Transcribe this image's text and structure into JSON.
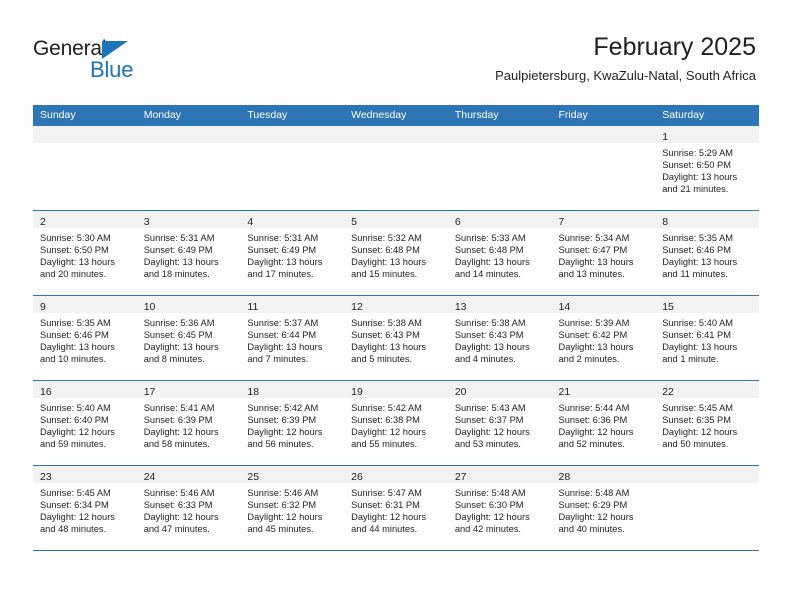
{
  "brand": {
    "name_top": "General",
    "name_bottom": "Blue",
    "accent_color": "#1b75bb"
  },
  "header": {
    "title": "February 2025",
    "subtitle": "Paulpietersburg, KwaZulu-Natal, South Africa"
  },
  "colors": {
    "header_row": "#2e75b6",
    "daynum_band": "#f2f2f2",
    "text": "#231f20"
  },
  "weekday_headers": [
    "Sunday",
    "Monday",
    "Tuesday",
    "Wednesday",
    "Thursday",
    "Friday",
    "Saturday"
  ],
  "weeks": [
    [
      {
        "day": "",
        "sunrise": "",
        "sunset": "",
        "daylight_line1": "",
        "daylight_line2": ""
      },
      {
        "day": "",
        "sunrise": "",
        "sunset": "",
        "daylight_line1": "",
        "daylight_line2": ""
      },
      {
        "day": "",
        "sunrise": "",
        "sunset": "",
        "daylight_line1": "",
        "daylight_line2": ""
      },
      {
        "day": "",
        "sunrise": "",
        "sunset": "",
        "daylight_line1": "",
        "daylight_line2": ""
      },
      {
        "day": "",
        "sunrise": "",
        "sunset": "",
        "daylight_line1": "",
        "daylight_line2": ""
      },
      {
        "day": "",
        "sunrise": "",
        "sunset": "",
        "daylight_line1": "",
        "daylight_line2": ""
      },
      {
        "day": "1",
        "sunrise": "Sunrise: 5:29 AM",
        "sunset": "Sunset: 6:50 PM",
        "daylight_line1": "Daylight: 13 hours",
        "daylight_line2": "and 21 minutes."
      }
    ],
    [
      {
        "day": "2",
        "sunrise": "Sunrise: 5:30 AM",
        "sunset": "Sunset: 6:50 PM",
        "daylight_line1": "Daylight: 13 hours",
        "daylight_line2": "and 20 minutes."
      },
      {
        "day": "3",
        "sunrise": "Sunrise: 5:31 AM",
        "sunset": "Sunset: 6:49 PM",
        "daylight_line1": "Daylight: 13 hours",
        "daylight_line2": "and 18 minutes."
      },
      {
        "day": "4",
        "sunrise": "Sunrise: 5:31 AM",
        "sunset": "Sunset: 6:49 PM",
        "daylight_line1": "Daylight: 13 hours",
        "daylight_line2": "and 17 minutes."
      },
      {
        "day": "5",
        "sunrise": "Sunrise: 5:32 AM",
        "sunset": "Sunset: 6:48 PM",
        "daylight_line1": "Daylight: 13 hours",
        "daylight_line2": "and 15 minutes."
      },
      {
        "day": "6",
        "sunrise": "Sunrise: 5:33 AM",
        "sunset": "Sunset: 6:48 PM",
        "daylight_line1": "Daylight: 13 hours",
        "daylight_line2": "and 14 minutes."
      },
      {
        "day": "7",
        "sunrise": "Sunrise: 5:34 AM",
        "sunset": "Sunset: 6:47 PM",
        "daylight_line1": "Daylight: 13 hours",
        "daylight_line2": "and 13 minutes."
      },
      {
        "day": "8",
        "sunrise": "Sunrise: 5:35 AM",
        "sunset": "Sunset: 6:46 PM",
        "daylight_line1": "Daylight: 13 hours",
        "daylight_line2": "and 11 minutes."
      }
    ],
    [
      {
        "day": "9",
        "sunrise": "Sunrise: 5:35 AM",
        "sunset": "Sunset: 6:46 PM",
        "daylight_line1": "Daylight: 13 hours",
        "daylight_line2": "and 10 minutes."
      },
      {
        "day": "10",
        "sunrise": "Sunrise: 5:36 AM",
        "sunset": "Sunset: 6:45 PM",
        "daylight_line1": "Daylight: 13 hours",
        "daylight_line2": "and 8 minutes."
      },
      {
        "day": "11",
        "sunrise": "Sunrise: 5:37 AM",
        "sunset": "Sunset: 6:44 PM",
        "daylight_line1": "Daylight: 13 hours",
        "daylight_line2": "and 7 minutes."
      },
      {
        "day": "12",
        "sunrise": "Sunrise: 5:38 AM",
        "sunset": "Sunset: 6:43 PM",
        "daylight_line1": "Daylight: 13 hours",
        "daylight_line2": "and 5 minutes."
      },
      {
        "day": "13",
        "sunrise": "Sunrise: 5:38 AM",
        "sunset": "Sunset: 6:43 PM",
        "daylight_line1": "Daylight: 13 hours",
        "daylight_line2": "and 4 minutes."
      },
      {
        "day": "14",
        "sunrise": "Sunrise: 5:39 AM",
        "sunset": "Sunset: 6:42 PM",
        "daylight_line1": "Daylight: 13 hours",
        "daylight_line2": "and 2 minutes."
      },
      {
        "day": "15",
        "sunrise": "Sunrise: 5:40 AM",
        "sunset": "Sunset: 6:41 PM",
        "daylight_line1": "Daylight: 13 hours",
        "daylight_line2": "and 1 minute."
      }
    ],
    [
      {
        "day": "16",
        "sunrise": "Sunrise: 5:40 AM",
        "sunset": "Sunset: 6:40 PM",
        "daylight_line1": "Daylight: 12 hours",
        "daylight_line2": "and 59 minutes."
      },
      {
        "day": "17",
        "sunrise": "Sunrise: 5:41 AM",
        "sunset": "Sunset: 6:39 PM",
        "daylight_line1": "Daylight: 12 hours",
        "daylight_line2": "and 58 minutes."
      },
      {
        "day": "18",
        "sunrise": "Sunrise: 5:42 AM",
        "sunset": "Sunset: 6:39 PM",
        "daylight_line1": "Daylight: 12 hours",
        "daylight_line2": "and 56 minutes."
      },
      {
        "day": "19",
        "sunrise": "Sunrise: 5:42 AM",
        "sunset": "Sunset: 6:38 PM",
        "daylight_line1": "Daylight: 12 hours",
        "daylight_line2": "and 55 minutes."
      },
      {
        "day": "20",
        "sunrise": "Sunrise: 5:43 AM",
        "sunset": "Sunset: 6:37 PM",
        "daylight_line1": "Daylight: 12 hours",
        "daylight_line2": "and 53 minutes."
      },
      {
        "day": "21",
        "sunrise": "Sunrise: 5:44 AM",
        "sunset": "Sunset: 6:36 PM",
        "daylight_line1": "Daylight: 12 hours",
        "daylight_line2": "and 52 minutes."
      },
      {
        "day": "22",
        "sunrise": "Sunrise: 5:45 AM",
        "sunset": "Sunset: 6:35 PM",
        "daylight_line1": "Daylight: 12 hours",
        "daylight_line2": "and 50 minutes."
      }
    ],
    [
      {
        "day": "23",
        "sunrise": "Sunrise: 5:45 AM",
        "sunset": "Sunset: 6:34 PM",
        "daylight_line1": "Daylight: 12 hours",
        "daylight_line2": "and 48 minutes."
      },
      {
        "day": "24",
        "sunrise": "Sunrise: 5:46 AM",
        "sunset": "Sunset: 6:33 PM",
        "daylight_line1": "Daylight: 12 hours",
        "daylight_line2": "and 47 minutes."
      },
      {
        "day": "25",
        "sunrise": "Sunrise: 5:46 AM",
        "sunset": "Sunset: 6:32 PM",
        "daylight_line1": "Daylight: 12 hours",
        "daylight_line2": "and 45 minutes."
      },
      {
        "day": "26",
        "sunrise": "Sunrise: 5:47 AM",
        "sunset": "Sunset: 6:31 PM",
        "daylight_line1": "Daylight: 12 hours",
        "daylight_line2": "and 44 minutes."
      },
      {
        "day": "27",
        "sunrise": "Sunrise: 5:48 AM",
        "sunset": "Sunset: 6:30 PM",
        "daylight_line1": "Daylight: 12 hours",
        "daylight_line2": "and 42 minutes."
      },
      {
        "day": "28",
        "sunrise": "Sunrise: 5:48 AM",
        "sunset": "Sunset: 6:29 PM",
        "daylight_line1": "Daylight: 12 hours",
        "daylight_line2": "and 40 minutes."
      },
      {
        "day": "",
        "sunrise": "",
        "sunset": "",
        "daylight_line1": "",
        "daylight_line2": ""
      }
    ]
  ]
}
